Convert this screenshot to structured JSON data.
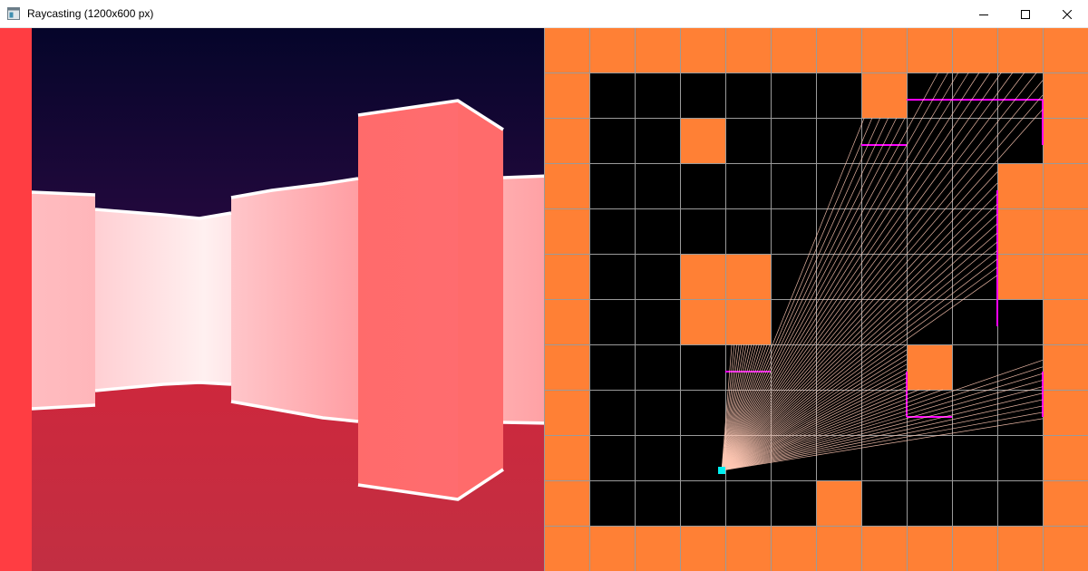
{
  "window": {
    "title": "Raycasting (1200x600 px)",
    "app_icon": "window-app-icon",
    "controls": [
      "minimize-icon",
      "maximize-icon",
      "close-icon"
    ]
  },
  "colors": {
    "sky_top": "#05052a",
    "sky_bottom": "#2e0a44",
    "floor_top": "#d2243a",
    "floor_bottom": "#c22f42",
    "left_strip": "#ff3d42",
    "wall_solid": "#ff6b6b",
    "wall_edge": "#ffffff",
    "map_wall": "#ff8035",
    "map_floor": "#000000",
    "map_grid": "#9a9a9a",
    "map_hit_edge": "#ff00ff",
    "ray": "#ffc8b4",
    "player": "#00f0f0"
  },
  "map": {
    "cols": 12,
    "rows": 12,
    "grid": [
      [
        1,
        1,
        1,
        1,
        1,
        1,
        1,
        1,
        1,
        1,
        1,
        1
      ],
      [
        1,
        0,
        0,
        0,
        0,
        0,
        0,
        1,
        0,
        0,
        0,
        1
      ],
      [
        1,
        0,
        0,
        1,
        0,
        0,
        0,
        0,
        0,
        0,
        0,
        1
      ],
      [
        1,
        0,
        0,
        0,
        0,
        0,
        0,
        0,
        0,
        0,
        1,
        1
      ],
      [
        1,
        0,
        0,
        0,
        0,
        0,
        0,
        0,
        0,
        0,
        1,
        1
      ],
      [
        1,
        0,
        0,
        1,
        1,
        0,
        0,
        0,
        0,
        0,
        1,
        1
      ],
      [
        1,
        0,
        0,
        1,
        1,
        0,
        0,
        0,
        0,
        0,
        0,
        1
      ],
      [
        1,
        0,
        0,
        0,
        0,
        0,
        0,
        0,
        1,
        0,
        0,
        1
      ],
      [
        1,
        0,
        0,
        0,
        0,
        0,
        0,
        0,
        0,
        0,
        0,
        1
      ],
      [
        1,
        0,
        0,
        0,
        0,
        0,
        0,
        0,
        0,
        0,
        0,
        1
      ],
      [
        1,
        0,
        0,
        0,
        0,
        0,
        1,
        0,
        0,
        0,
        0,
        1
      ],
      [
        1,
        1,
        1,
        1,
        1,
        1,
        1,
        1,
        1,
        1,
        1,
        1
      ]
    ],
    "player": {
      "x": 3.92,
      "y": 9.78
    }
  }
}
